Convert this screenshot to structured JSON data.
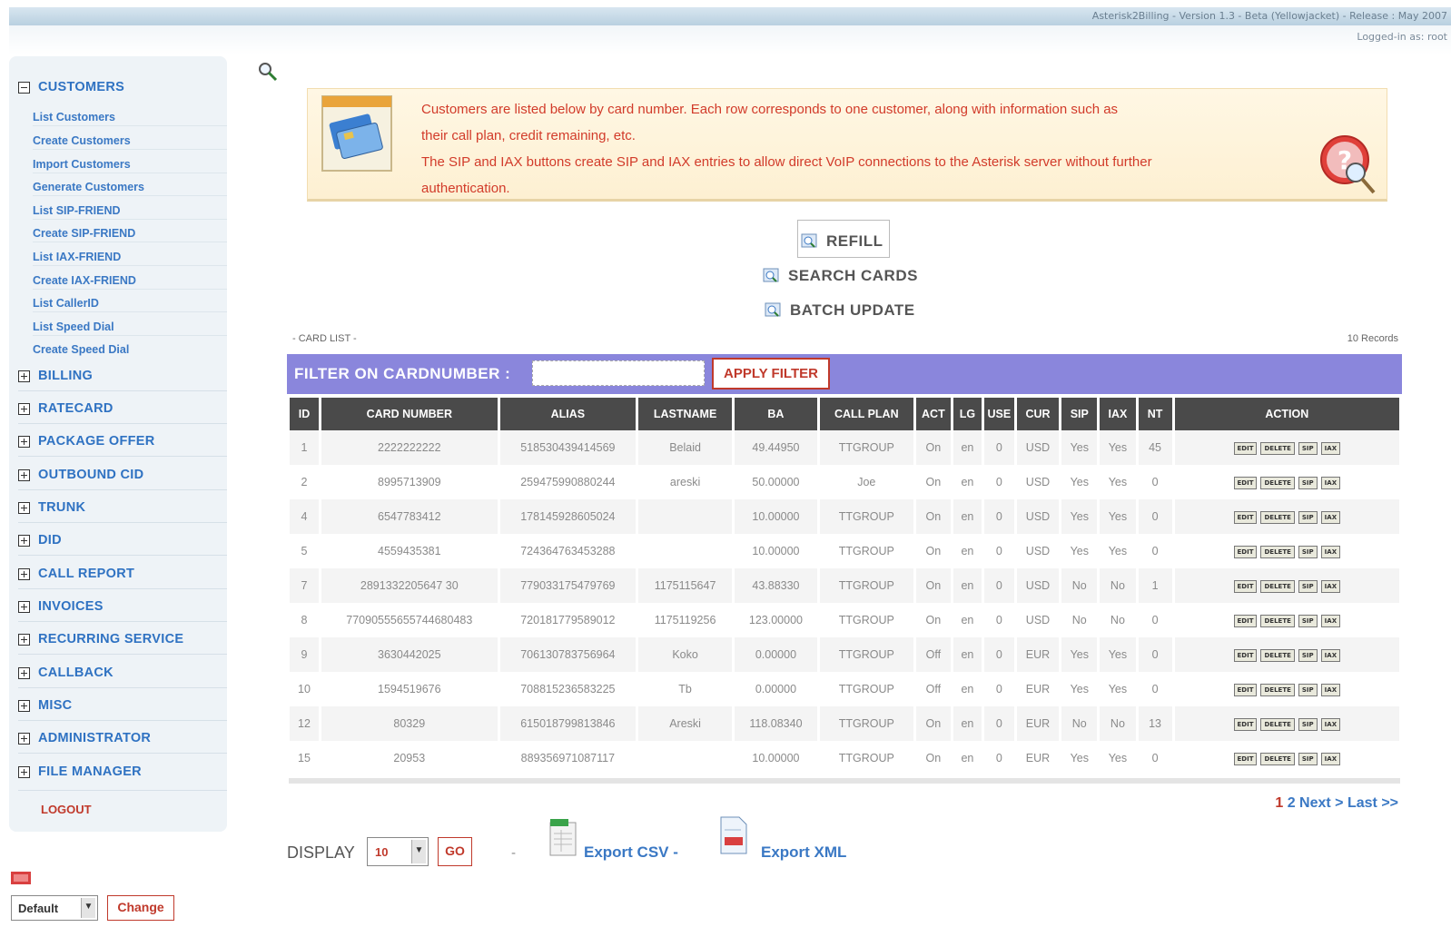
{
  "header": {
    "version": "Asterisk2Billing - Version 1.3 - Beta (Yellowjacket) - Release : May 2007",
    "logged_in": "Logged-in as: root"
  },
  "sidebar": {
    "sections": [
      {
        "label": "CUSTOMERS",
        "expanded": true
      },
      {
        "label": "BILLING"
      },
      {
        "label": "RATECARD"
      },
      {
        "label": "PACKAGE OFFER"
      },
      {
        "label": "OUTBOUND CID"
      },
      {
        "label": "TRUNK"
      },
      {
        "label": "DID"
      },
      {
        "label": "CALL REPORT"
      },
      {
        "label": "INVOICES"
      },
      {
        "label": "RECURRING SERVICE"
      },
      {
        "label": "CALLBACK"
      },
      {
        "label": "MISC"
      },
      {
        "label": "ADMINISTRATOR"
      },
      {
        "label": "FILE MANAGER"
      }
    ],
    "customer_items": [
      "List Customers",
      "Create Customers",
      "Import Customers",
      "Generate Customers",
      "List SIP-FRIEND",
      "Create SIP-FRIEND",
      "List IAX-FRIEND",
      "Create IAX-FRIEND",
      "List CallerID",
      "List Speed Dial",
      "Create Speed Dial"
    ],
    "logout": "LOGOUT"
  },
  "theme": {
    "selected": "Default",
    "change_label": "Change"
  },
  "info": {
    "line1": "Customers are listed below by card number. Each row corresponds to one customer, along with information such as",
    "line2": "their call plan, credit remaining, etc.",
    "line3": "The SIP and IAX buttons create SIP and IAX entries to allow direct VoIP connections to the Asterisk server without further",
    "line4": "authentication."
  },
  "actions": {
    "refill": "REFILL",
    "search": "SEARCH CARDS",
    "batch": "BATCH UPDATE"
  },
  "list": {
    "title": "- CARD LIST -",
    "records": "10 Records"
  },
  "filter": {
    "label": "FILTER ON CARDNUMBER :",
    "value": "",
    "button": "APPLY FILTER"
  },
  "table": {
    "columns": [
      "ID",
      "CARD NUMBER",
      "ALIAS",
      "LASTNAME",
      "BA",
      "CALL PLAN",
      "ACT",
      "LG",
      "USE",
      "CUR",
      "SIP",
      "IAX",
      "NT",
      "ACTION"
    ],
    "rows": [
      [
        "1",
        "2222222222",
        "518530439414569",
        "Belaid",
        "49.44950",
        "TTGROUP",
        "On",
        "en",
        "0",
        "USD",
        "Yes",
        "Yes",
        "45"
      ],
      [
        "2",
        "8995713909",
        "259475990880244",
        "areski",
        "50.00000",
        "Joe",
        "On",
        "en",
        "0",
        "USD",
        "Yes",
        "Yes",
        "0"
      ],
      [
        "4",
        "6547783412",
        "178145928605024",
        "",
        "10.00000",
        "TTGROUP",
        "On",
        "en",
        "0",
        "USD",
        "Yes",
        "Yes",
        "0"
      ],
      [
        "5",
        "4559435381",
        "724364763453288",
        "",
        "10.00000",
        "TTGROUP",
        "On",
        "en",
        "0",
        "USD",
        "Yes",
        "Yes",
        "0"
      ],
      [
        "7",
        "2891332205647 30",
        "779033175479769",
        "1175115647",
        "43.88330",
        "TTGROUP",
        "On",
        "en",
        "0",
        "USD",
        "No",
        "No",
        "1"
      ],
      [
        "8",
        "77090555655744680483",
        "720181779589012",
        "1175119256",
        "123.00000",
        "TTGROUP",
        "On",
        "en",
        "0",
        "USD",
        "No",
        "No",
        "0"
      ],
      [
        "9",
        "3630442025",
        "706130783756964",
        "Koko",
        "0.00000",
        "TTGROUP",
        "Off",
        "en",
        "0",
        "EUR",
        "Yes",
        "Yes",
        "0"
      ],
      [
        "10",
        "1594519676",
        "708815236583225",
        "Tb",
        "0.00000",
        "TTGROUP",
        "Off",
        "en",
        "0",
        "EUR",
        "Yes",
        "Yes",
        "0"
      ],
      [
        "12",
        "80329",
        "615018799813846",
        "Areski",
        "118.08340",
        "TTGROUP",
        "On",
        "en",
        "0",
        "EUR",
        "No",
        "No",
        "13"
      ],
      [
        "15",
        "20953",
        "889356971087117",
        "",
        "10.00000",
        "TTGROUP",
        "On",
        "en",
        "0",
        "EUR",
        "Yes",
        "Yes",
        "0"
      ]
    ],
    "row_actions": [
      "EDIT",
      "DELETE",
      "SIP",
      "IAX"
    ]
  },
  "pagination": {
    "p1": "1",
    "p2": "2",
    "next": "Next >",
    "last": "Last >>"
  },
  "footer": {
    "display_label": "DISPLAY",
    "display_value": "10",
    "go": "GO",
    "sep1": "-",
    "export_csv": "Export CSV -",
    "export_xml": "Export XML"
  }
}
